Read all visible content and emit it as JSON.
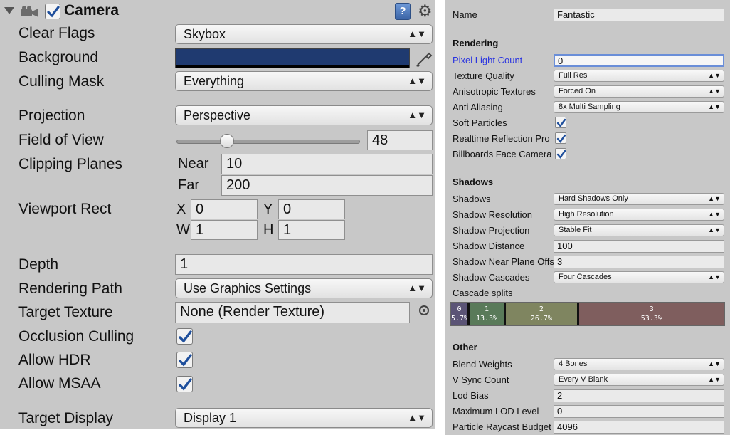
{
  "camera": {
    "title": "Camera",
    "clear_flags": {
      "label": "Clear Flags",
      "value": "Skybox"
    },
    "background": {
      "label": "Background",
      "color": "#1f3a70"
    },
    "culling_mask": {
      "label": "Culling Mask",
      "value": "Everything"
    },
    "projection": {
      "label": "Projection",
      "value": "Perspective"
    },
    "field_of_view": {
      "label": "Field of View",
      "value": "48"
    },
    "clipping_planes": {
      "label": "Clipping Planes",
      "near_label": "Near",
      "near": "10",
      "far_label": "Far",
      "far": "200"
    },
    "viewport_rect": {
      "label": "Viewport Rect",
      "x_label": "X",
      "x": "0",
      "y_label": "Y",
      "y": "0",
      "w_label": "W",
      "w": "1",
      "h_label": "H",
      "h": "1"
    },
    "depth": {
      "label": "Depth",
      "value": "1"
    },
    "rendering_path": {
      "label": "Rendering Path",
      "value": "Use Graphics Settings"
    },
    "target_texture": {
      "label": "Target Texture",
      "value": "None (Render Texture)"
    },
    "occlusion_culling": {
      "label": "Occlusion Culling"
    },
    "allow_hdr": {
      "label": "Allow HDR"
    },
    "allow_msaa": {
      "label": "Allow MSAA"
    },
    "target_display": {
      "label": "Target Display",
      "value": "Display 1"
    }
  },
  "quality": {
    "name": {
      "label": "Name",
      "value": "Fantastic"
    },
    "rendering_header": "Rendering",
    "pixel_light_count": {
      "label": "Pixel Light Count",
      "value": "0"
    },
    "texture_quality": {
      "label": "Texture Quality",
      "value": "Full Res"
    },
    "anisotropic_textures": {
      "label": "Anisotropic Textures",
      "value": "Forced On"
    },
    "anti_aliasing": {
      "label": "Anti Aliasing",
      "value": "8x Multi Sampling"
    },
    "soft_particles": {
      "label": "Soft Particles"
    },
    "realtime_reflection": {
      "label": "Realtime Reflection Pro"
    },
    "billboards": {
      "label": "Billboards Face Camera"
    },
    "shadows_header": "Shadows",
    "shadows": {
      "label": "Shadows",
      "value": "Hard Shadows Only"
    },
    "shadow_resolution": {
      "label": "Shadow Resolution",
      "value": "High Resolution"
    },
    "shadow_projection": {
      "label": "Shadow Projection",
      "value": "Stable Fit"
    },
    "shadow_distance": {
      "label": "Shadow Distance",
      "value": "100"
    },
    "shadow_near_plane": {
      "label": "Shadow Near Plane Offset",
      "value": "3"
    },
    "shadow_cascades": {
      "label": "Shadow Cascades",
      "value": "Four Cascades"
    },
    "cascade_splits": {
      "label": "Cascade splits",
      "segments": [
        {
          "index": "0",
          "percent": "5.7%",
          "color": "#5b5476"
        },
        {
          "index": "1",
          "percent": "13.3%",
          "color": "#597a59"
        },
        {
          "index": "2",
          "percent": "26.7%",
          "color": "#7f8560"
        },
        {
          "index": "3",
          "percent": "53.3%",
          "color": "#7f5e5e"
        }
      ]
    },
    "other_header": "Other",
    "blend_weights": {
      "label": "Blend Weights",
      "value": "4 Bones"
    },
    "vsync_count": {
      "label": "V Sync Count",
      "value": "Every V Blank"
    },
    "lod_bias": {
      "label": "Lod Bias",
      "value": "2"
    },
    "max_lod_level": {
      "label": "Maximum LOD Level",
      "value": "0"
    },
    "particle_raycast_budget": {
      "label": "Particle Raycast Budget",
      "value": "4096"
    }
  },
  "accent_color": "#2a34e0"
}
